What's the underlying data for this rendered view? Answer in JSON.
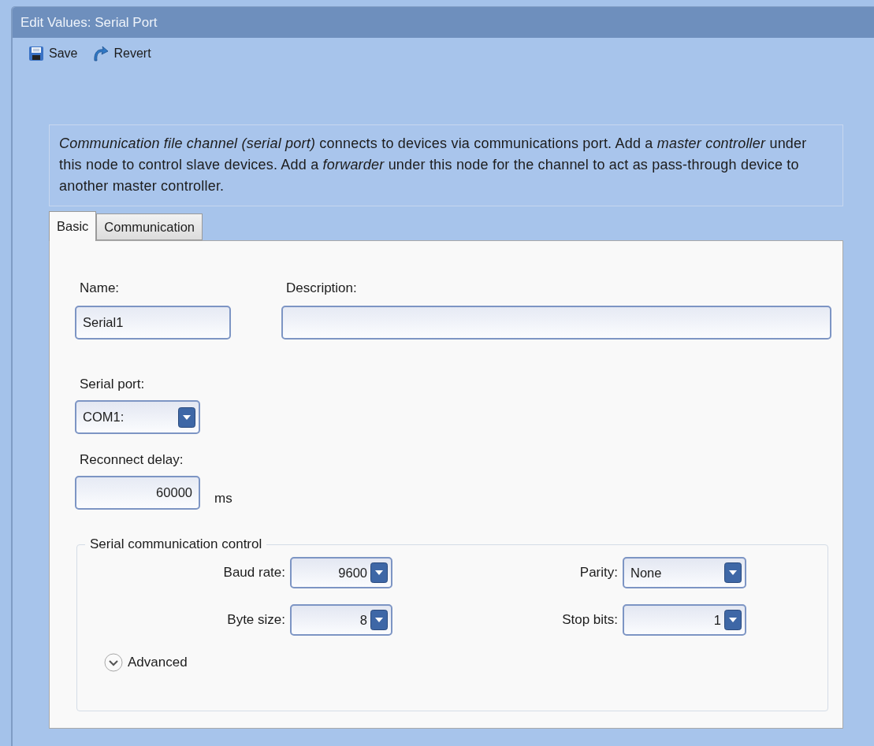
{
  "window": {
    "title": "Edit Values: Serial Port"
  },
  "toolbar": [
    {
      "kind": "save",
      "label": "Save"
    },
    {
      "kind": "revert",
      "label": "Revert"
    }
  ],
  "description": "*Communication file channel (serial port)* connects to devices via communications port. Add a *master controller* under this node to control slave devices. Add a *forwarder* under this node for the channel to act as pass-through device to another master controller.",
  "tabs": [
    {
      "label": "Basic",
      "selected": true
    },
    {
      "label": "Communication",
      "selected": false
    }
  ],
  "name": {
    "label": "Name:",
    "value": "Serial1"
  },
  "description_field": {
    "label": "Description:"
  },
  "serial_port": {
    "label": "Serial port:",
    "value": "COM1:"
  },
  "reconnect_delay": {
    "label": "Reconnect delay:",
    "value": "60000",
    "unit": "ms"
  },
  "group": {
    "title": "Serial communication control",
    "fields": [
      {
        "label": "Baud rate:",
        "value": "9600",
        "kind": "numeric"
      },
      {
        "label": "Parity:",
        "value": "None",
        "kind": "text"
      },
      {
        "label": "Byte size:",
        "value": "8",
        "kind": "numeric"
      },
      {
        "label": "Stop bits:",
        "value": "1",
        "kind": "numeric"
      }
    ],
    "advanced": {
      "label": "Advanced",
      "expanded": false
    }
  }
}
